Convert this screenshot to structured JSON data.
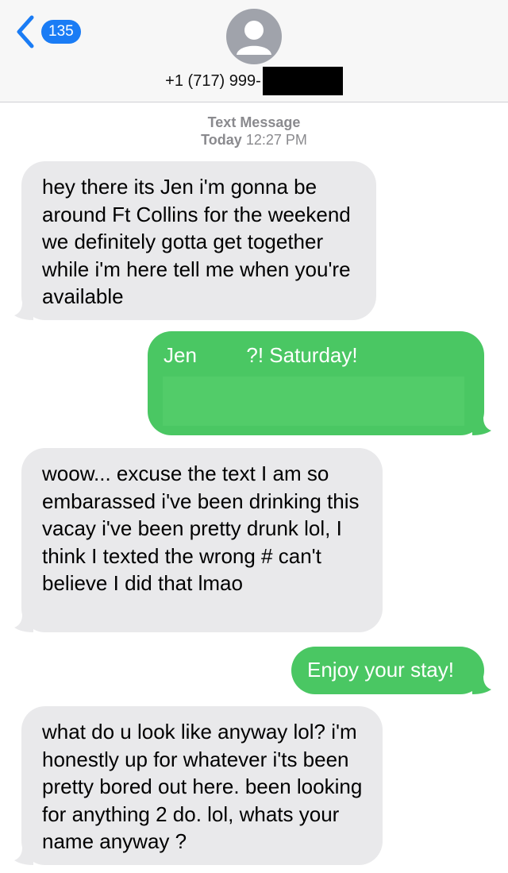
{
  "header": {
    "back_count": "135",
    "contact_number": "+1 (717) 999-"
  },
  "thread": {
    "service_label": "Text Message",
    "day": "Today",
    "time": "12:27 PM"
  },
  "messages": [
    {
      "direction": "incoming",
      "text": "hey there its Jen  i'm gonna be around Ft Collins for the weekend we definitely gotta get together while i'm here tell me when you're available"
    },
    {
      "direction": "outgoing",
      "text_start": "Jen",
      "text_end": "?! Saturday!"
    },
    {
      "direction": "incoming",
      "text": "woow... excuse the text  I am so embarassed i've been drinking this vacay i've been pretty drunk lol, I think I texted the wrong # can't believe I did that lmao"
    },
    {
      "direction": "outgoing",
      "text": "Enjoy your stay!"
    },
    {
      "direction": "incoming",
      "text": "what do u look like anyway lol? i'm honestly up for whatever i'ts been pretty bored out here. been looking for anything 2 do. lol, whats your name anyway ?"
    }
  ],
  "colors": {
    "accent": "#1a7cf5",
    "outgoing_bubble": "#4ac763",
    "incoming_bubble": "#e9e9eb"
  },
  "icons": {
    "back": "chevron-left-icon",
    "avatar": "person-avatar-icon"
  }
}
